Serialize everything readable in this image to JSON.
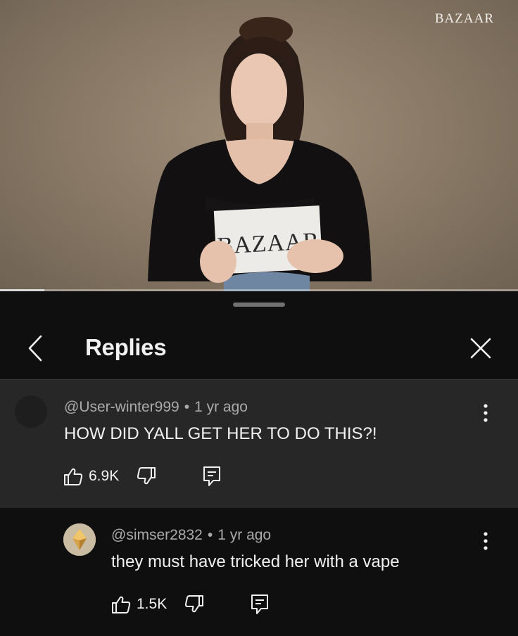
{
  "video": {
    "watermark": "BAZAAR",
    "card_text": "BAZAAR",
    "progress": 0.085
  },
  "sheet": {
    "title": "Replies",
    "back_icon": "chevron-left-icon",
    "close_icon": "close-icon"
  },
  "comments": [
    {
      "handle": "@User-winter999",
      "separator": "•",
      "time": "1 yr ago",
      "text": "HOW DID YALL GET HER TO DO THIS?!",
      "likes": "6.9K",
      "highlighted": true
    },
    {
      "handle": "@simser2832",
      "separator": "•",
      "time": "1 yr ago",
      "text": "they must have tricked her with a vape",
      "likes": "1.5K",
      "highlighted": false
    }
  ],
  "colors": {
    "background": "#0f0f0f",
    "highlight": "#272727",
    "text_primary": "#f1f1f1",
    "text_secondary": "#aaaaaa"
  }
}
